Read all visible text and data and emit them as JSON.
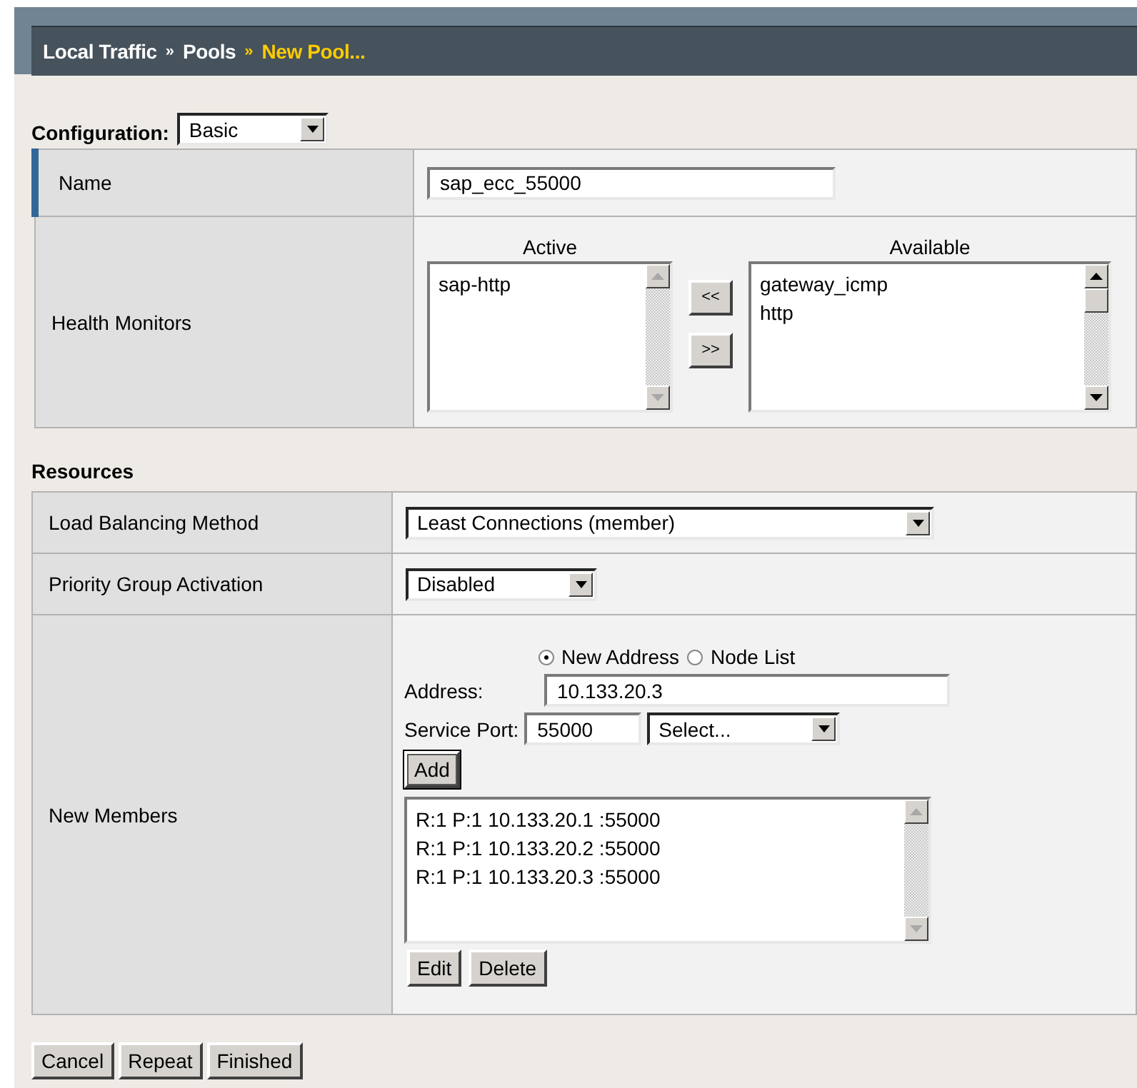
{
  "breadcrumb": [
    {
      "label": "Local Traffic",
      "current": false
    },
    {
      "separator": "»",
      "label": "Pools",
      "current": false
    },
    {
      "separator": "»",
      "label": "New Pool...",
      "current": true
    }
  ],
  "configuration": {
    "label": "Configuration:",
    "value": "Basic"
  },
  "general": {
    "name": {
      "label": "Name",
      "value": "sap_ecc_55000",
      "focused": true
    },
    "health_monitors": {
      "label": "Health Monitors",
      "active_heading": "Active",
      "active": [
        "sap-http"
      ],
      "active_scrollable": false,
      "move_left_button": "<<",
      "move_right_button": ">>",
      "available_heading": "Available",
      "available": [
        "gateway_icmp",
        "http"
      ],
      "available_scrollable": true
    }
  },
  "resources": {
    "heading": "Resources",
    "load_balancing": {
      "label": "Load Balancing Method",
      "value": "Least Connections (member)"
    },
    "priority_group": {
      "label": "Priority Group Activation",
      "value": "Disabled"
    },
    "new_members": {
      "label": "New Members",
      "radios": [
        {
          "label": "New Address",
          "selected": true
        },
        {
          "label": "Node List",
          "selected": false
        }
      ],
      "address_label": "Address:",
      "address": "10.133.20.3",
      "port_label": "Service Port:",
      "port": "55000",
      "port_select": "Select...",
      "add_button": "Add",
      "members": [
        "R:1 P:1 10.133.20.1 :55000",
        "R:1 P:1 10.133.20.2 :55000",
        "R:1 P:1 10.133.20.3 :55000"
      ],
      "members_scrollable": false,
      "edit_button": "Edit",
      "delete_button": "Delete"
    }
  },
  "buttons": [
    "Cancel",
    "Repeat",
    "Finished"
  ]
}
